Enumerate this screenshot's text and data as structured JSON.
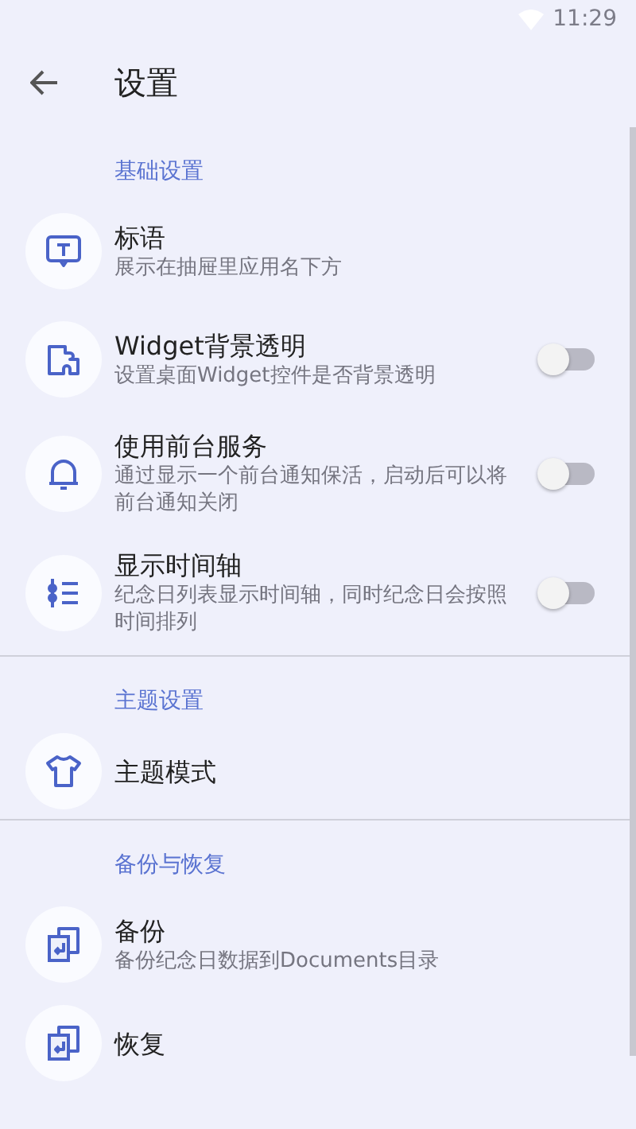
{
  "status_bar": {
    "time": "11:29"
  },
  "app_bar": {
    "title": "设置"
  },
  "sections": [
    {
      "title": "基础设置",
      "items": [
        {
          "title": "标语",
          "subtitle": "展示在抽屉里应用名下方",
          "kind": "plain"
        },
        {
          "title": "Widget背景透明",
          "subtitle": "设置桌面Widget控件是否背景透明",
          "kind": "switch",
          "on": false
        },
        {
          "title": "使用前台服务",
          "subtitle": "通过显示一个前台通知保活，启动后可以将前台通知关闭",
          "kind": "switch",
          "on": false
        },
        {
          "title": "显示时间轴",
          "subtitle": "纪念日列表显示时间轴，同时纪念日会按照时间排列",
          "kind": "switch",
          "on": false
        }
      ]
    },
    {
      "title": "主题设置",
      "items": [
        {
          "title": "主题模式",
          "kind": "plain"
        }
      ]
    },
    {
      "title": "备份与恢复",
      "items": [
        {
          "title": "备份",
          "subtitle": "备份纪念日数据到Documents目录",
          "kind": "plain"
        },
        {
          "title": "恢复",
          "kind": "plain"
        }
      ]
    }
  ]
}
